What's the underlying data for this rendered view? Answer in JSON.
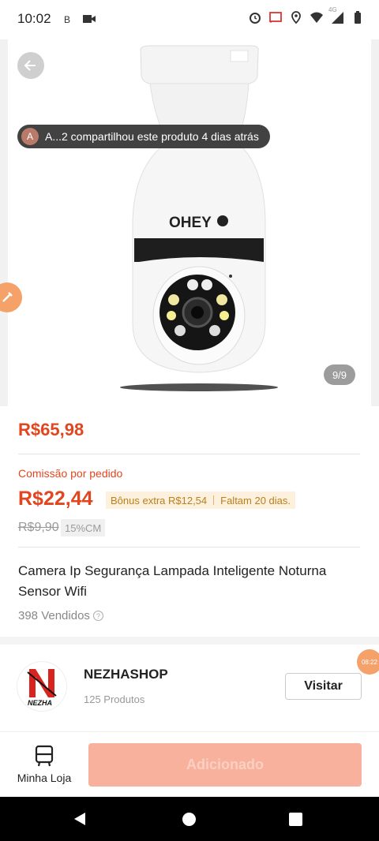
{
  "status_bar": {
    "time": "10:02",
    "icons": [
      "notification-b-icon",
      "video-icon",
      "alarm-icon",
      "cast-icon",
      "location-icon",
      "wifi-icon",
      "signal-4g-icon",
      "battery-icon"
    ],
    "network_label": "4G"
  },
  "gallery": {
    "share_avatar": "A",
    "share_text": "A...2 compartilhou este produto 4 dias atrás",
    "image_counter": "9/9",
    "product_brand_on_image": "OHEY"
  },
  "pricing": {
    "price": "R$65,98",
    "commission_label": "Comissão por pedido",
    "commission_value": "R$22,44",
    "bonus_text": "Bônus extra R$12,54",
    "days_left": "Faltam 20 dias.",
    "old_price": "R$9,90",
    "cm_badge": "15%CM"
  },
  "product": {
    "title": "Camera Ip Segurança Lampada Inteligente Noturna Sensor Wifi",
    "sold": "398 Vendidos"
  },
  "shop": {
    "logo_text": "NEZHA",
    "name": "NEZHASHOP",
    "product_count": "125 Produtos",
    "visit_label": "Visitar",
    "timer": "08:22"
  },
  "bottom_bar": {
    "my_store_label": "Minha Loja",
    "add_label": "Adicionado"
  },
  "colors": {
    "accent": "#e2461f",
    "bonus_bg": "#fdf1dd",
    "add_button": "#f7b19c"
  }
}
